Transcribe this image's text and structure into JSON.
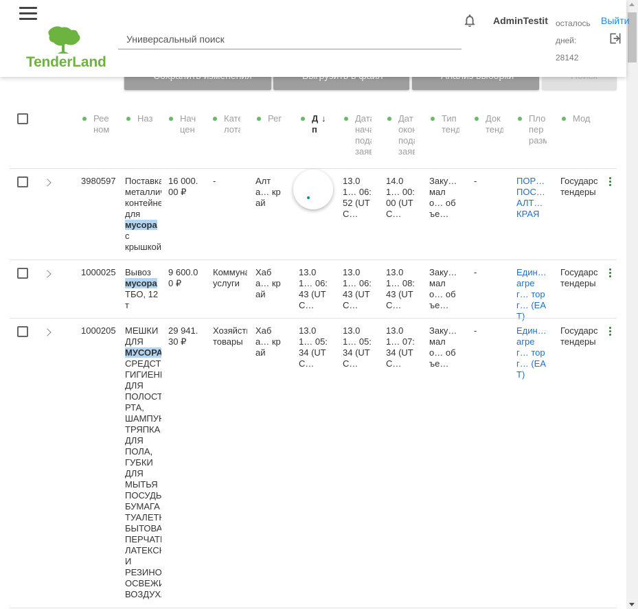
{
  "header": {
    "logo_text": "TenderLand",
    "search_placeholder": "Универсальный поиск",
    "username": "AdminTestit",
    "days_left_label": "осталось дней:",
    "days_left_value": "28142",
    "logout_label": "Выйти"
  },
  "toolbar": {
    "save_label": "Сохранить изменения",
    "export_label": "Выгрузить в файл",
    "analysis_label": "Анализ выборки",
    "search_label": "Поиск"
  },
  "columns": [
    {
      "label": "Реестровый номер",
      "display": "Рее ном"
    },
    {
      "label": "Название",
      "display": "Наз"
    },
    {
      "label": "Начальная цена",
      "display": "Нач цен"
    },
    {
      "label": "Категория лота",
      "display": "Кате лота"
    },
    {
      "label": "Регион",
      "display": "Рег"
    },
    {
      "label": "Дата публикации",
      "display": "Д п",
      "sort": "↓"
    },
    {
      "label": "Дата начала подачи заявок",
      "display": "Дата нача пода заяв"
    },
    {
      "label": "Дата окончания подачи заявок",
      "display": "Дат окон пода заяв"
    },
    {
      "label": "Тип тендера",
      "display": "Тип тенд"
    },
    {
      "label": "Документы тендера",
      "display": "Док тенд"
    },
    {
      "label": "Площадка размещения",
      "display": "Пло пер разм"
    },
    {
      "label": "Модуль",
      "display": "Мод"
    }
  ],
  "rows": [
    {
      "number": "3980597",
      "name_before": "Поставка металлический контейнер для ",
      "name_highlight": "мусора",
      "name_after": " с крышкой",
      "price": "16 000.00 ₽",
      "category": "-",
      "region": "Алта… край",
      "published": "",
      "start": "13.01… 06:52 (UTC…",
      "end": "14.01… 00:00 (UTC…",
      "type": "Заку… мало… объе…",
      "docs": "-",
      "platform": "ПОР… ПОС… АЛТ… КРАЯ",
      "module": "Государс тендеры"
    },
    {
      "number": "1000025",
      "name_before": "Вывоз ",
      "name_highlight": "мусора",
      "name_after": " ТБО, 12 т",
      "price": "9 600.00 ₽",
      "category": "Коммунал услуги",
      "region": "Хаба… край",
      "published": "13.01… 06:43 (UTC…",
      "start": "13.01… 06:43 (UTC…",
      "end": "13.01… 08:43 (UTC…",
      "type": "Заку… мало… объе…",
      "docs": "-",
      "platform": "Един… агрег… торг… (ЕАТ)",
      "module": "Государс тендеры"
    },
    {
      "number": "1000205",
      "name_before": "МЕШКИ ДЛЯ ",
      "name_highlight": "МУСОРА",
      "name_after": " СРЕДСТВ ГИГИЕНЫ ДЛЯ ПОЛОСТИ РТА, ШАМПУНЬ ТРЯПКА ДЛЯ ПОЛА, ГУБКИ ДЛЯ МЫТЬЯ ПОСУДЫ БУМАГА ТУАЛЕТНАЯ БЫТОВАЯ ПЕРЧАТКИ ЛАТЕКСНЫЕ И РЕЗИНОВЫЕ ОСВЕЖИТЕЛЬ ВОЗДУХА",
      "price": "29 941.30 ₽",
      "category": "Хозяйств товары",
      "region": "Хаба… край",
      "published": "13.01… 05:34 (UTC…",
      "start": "13.01… 05:34 (UTC…",
      "end": "13.01… 07:34 (UTC…",
      "type": "Заку… мало… объе…",
      "docs": "-",
      "platform": "Един… агрег… торг… (ЕАТ)",
      "module": "Государс тендеры"
    }
  ],
  "colors": {
    "accent": "#6db33f",
    "link": "#1e70c9",
    "dot": "#66bb6a",
    "highlight": "#b3d7f2"
  },
  "icons": [
    "menu-icon",
    "bell-icon",
    "logout-icon",
    "chevron-right-icon",
    "more-vert-icon"
  ]
}
